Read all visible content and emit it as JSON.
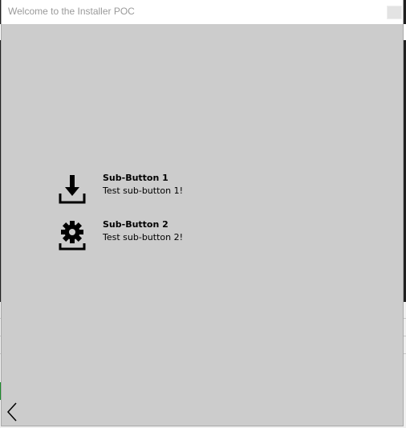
{
  "window": {
    "title": "Welcome to the Installer POC"
  },
  "sub_buttons": [
    {
      "label": "Sub-Button 1",
      "description": "Test sub-button 1!",
      "icon": "download-icon"
    },
    {
      "label": "Sub-Button 2",
      "description": "Test sub-button 2!",
      "icon": "gear-install-icon"
    }
  ],
  "navigation": {
    "back_icon": "chevron-left-icon"
  },
  "colors": {
    "dialog_background": "#cccccc",
    "titlebar_background": "#ffffff",
    "title_text": "#9a9a9a",
    "icon_color": "#000000"
  }
}
